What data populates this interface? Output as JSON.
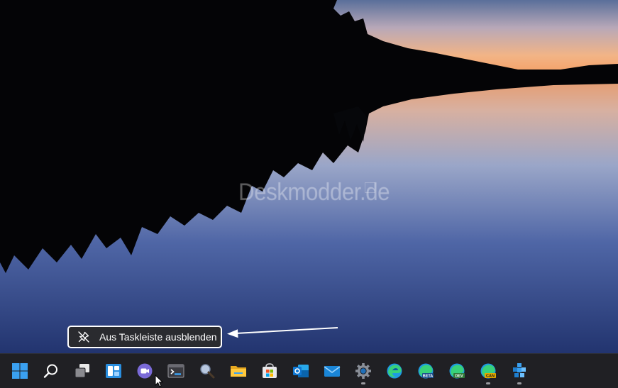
{
  "wallpaper": {
    "watermark": "Deskmodder.de"
  },
  "context_menu": {
    "label": "Aus Taskleiste ausblenden",
    "icon": "unpin-icon"
  },
  "taskbar": {
    "items": [
      {
        "name": "start-button",
        "icon": "windows-logo-icon",
        "running": false
      },
      {
        "name": "search-button",
        "icon": "search-icon",
        "running": false
      },
      {
        "name": "task-view-button",
        "icon": "task-view-icon",
        "running": false
      },
      {
        "name": "widgets-button",
        "icon": "widgets-icon",
        "running": false
      },
      {
        "name": "chat-button",
        "icon": "chat-icon",
        "running": false
      },
      {
        "name": "terminal-button",
        "icon": "terminal-icon",
        "running": false
      },
      {
        "name": "magnifier-button",
        "icon": "magnifier-icon",
        "running": false
      },
      {
        "name": "file-explorer-button",
        "icon": "folder-icon",
        "running": false
      },
      {
        "name": "store-button",
        "icon": "store-icon",
        "running": false
      },
      {
        "name": "outlook-button",
        "icon": "outlook-icon",
        "running": false
      },
      {
        "name": "mail-button",
        "icon": "mail-icon",
        "running": false
      },
      {
        "name": "settings-button",
        "icon": "settings-gear-icon",
        "running": true
      },
      {
        "name": "edge-button",
        "icon": "edge-icon",
        "running": false
      },
      {
        "name": "edge-beta-button",
        "icon": "edge-beta-icon",
        "badge": "BETA",
        "running": false
      },
      {
        "name": "edge-dev-button",
        "icon": "edge-dev-icon",
        "badge": "DEV",
        "running": false
      },
      {
        "name": "edge-canary-button",
        "icon": "edge-canary-icon",
        "badge": "CAN",
        "running": true
      },
      {
        "name": "app-button",
        "icon": "cube-app-icon",
        "running": true
      }
    ]
  },
  "colors": {
    "taskbar_bg": "#202024",
    "accent_blue": "#3aa0f0",
    "menu_bg": "#2a2b2f",
    "sky_orange": "#f7a36a"
  }
}
